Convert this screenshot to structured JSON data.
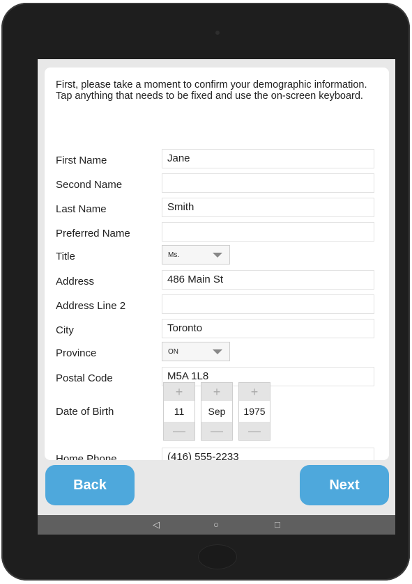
{
  "intro": "First, please take a moment to confirm your demographic information. Tap anything that needs to be fixed and use the on-screen keyboard.",
  "fields": [
    {
      "label": "First Name",
      "value": "Jane"
    },
    {
      "label": "Second Name",
      "value": ""
    },
    {
      "label": "Last Name",
      "value": "Smith"
    },
    {
      "label": "Preferred Name",
      "value": ""
    },
    {
      "label": "Title",
      "value": "Ms."
    },
    {
      "label": "Address",
      "value": "486 Main St"
    },
    {
      "label": "Address Line 2",
      "value": ""
    },
    {
      "label": "City",
      "value": "Toronto"
    },
    {
      "label": "Province",
      "value": "ON"
    },
    {
      "label": "Postal Code",
      "value": "M5A 1L8"
    },
    {
      "label": "Date of Birth",
      "value": ""
    },
    {
      "label": "Home Phone",
      "value": "(416) 555-2233"
    }
  ],
  "dob": {
    "day": "11",
    "month": "Sep",
    "year": "1975",
    "plus": "+",
    "minus": "—"
  },
  "buttons": {
    "back": "Back",
    "next": "Next"
  },
  "nav": {
    "back_glyph": "◁",
    "home_glyph": "○",
    "recents_glyph": "□"
  },
  "colors": {
    "accent": "#4ea8dc",
    "navbar": "#5f5f5f"
  }
}
